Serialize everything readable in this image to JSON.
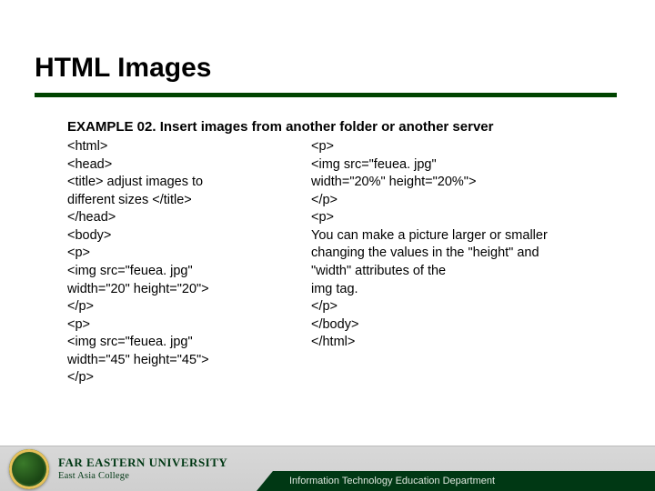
{
  "title": "HTML Images",
  "example_heading": "EXAMPLE 02. Insert images from another folder or another server",
  "code_left": "<html>\n<head>\n<title> adjust images to\ndifferent sizes </title>\n</head>\n<body>\n<p>\n<img src=\"feuea. jpg\"\nwidth=\"20\" height=\"20\">\n</p>\n<p>\n<img src=\"feuea. jpg\"\nwidth=\"45\" height=\"45\">\n</p>",
  "code_right": "<p>\n<img src=\"feuea. jpg\"\nwidth=\"20%\" height=\"20%\">\n</p>\n<p>\nYou can make a picture larger or smaller\nchanging the values in the \"height\" and\n\"width\" attributes of the\nimg tag.\n</p>\n</body>\n</html>",
  "footer": {
    "university": "FAR EASTERN UNIVERSITY",
    "college": "East Asia College",
    "department": "Information Technology Education Department"
  }
}
